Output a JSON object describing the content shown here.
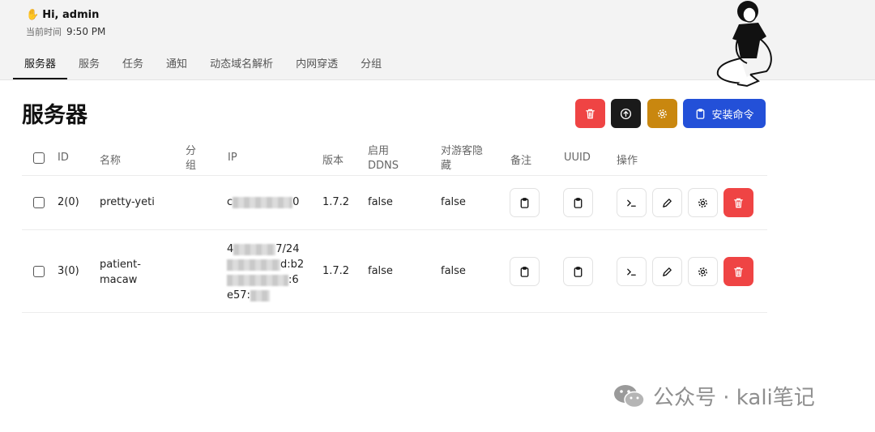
{
  "header": {
    "greeting": "Hi, admin",
    "time_label": "当前时间",
    "time_value": "9:50 PM",
    "tabs": [
      "服务器",
      "服务",
      "任务",
      "通知",
      "动态域名解析",
      "内网穿透",
      "分组"
    ]
  },
  "page": {
    "title": "服务器",
    "install_label": "安装命令",
    "colors": {
      "red": "#ef4444",
      "black": "#1a1a1a",
      "amber": "#c9870f",
      "blue": "#2350d8"
    }
  },
  "table": {
    "headers": [
      "ID",
      "名称",
      "分组",
      "IP",
      "版本",
      "启用DDNS",
      "对游客隐藏",
      "备注",
      "UUID",
      "操作"
    ],
    "rows": [
      {
        "id": "2(0)",
        "name": "pretty-yeti",
        "group": "",
        "ip_visible": [
          "c",
          "0"
        ],
        "version": "1.7.2",
        "ddns": "false",
        "hidden": "false"
      },
      {
        "id": "3(0)",
        "name": "patient-macaw",
        "group": "",
        "ip_visible": [
          "4",
          "7/24",
          "d:b2",
          ":6",
          "e57:"
        ],
        "version": "1.7.2",
        "ddns": "false",
        "hidden": "false"
      }
    ]
  },
  "watermark": "公众号 · kali笔记"
}
